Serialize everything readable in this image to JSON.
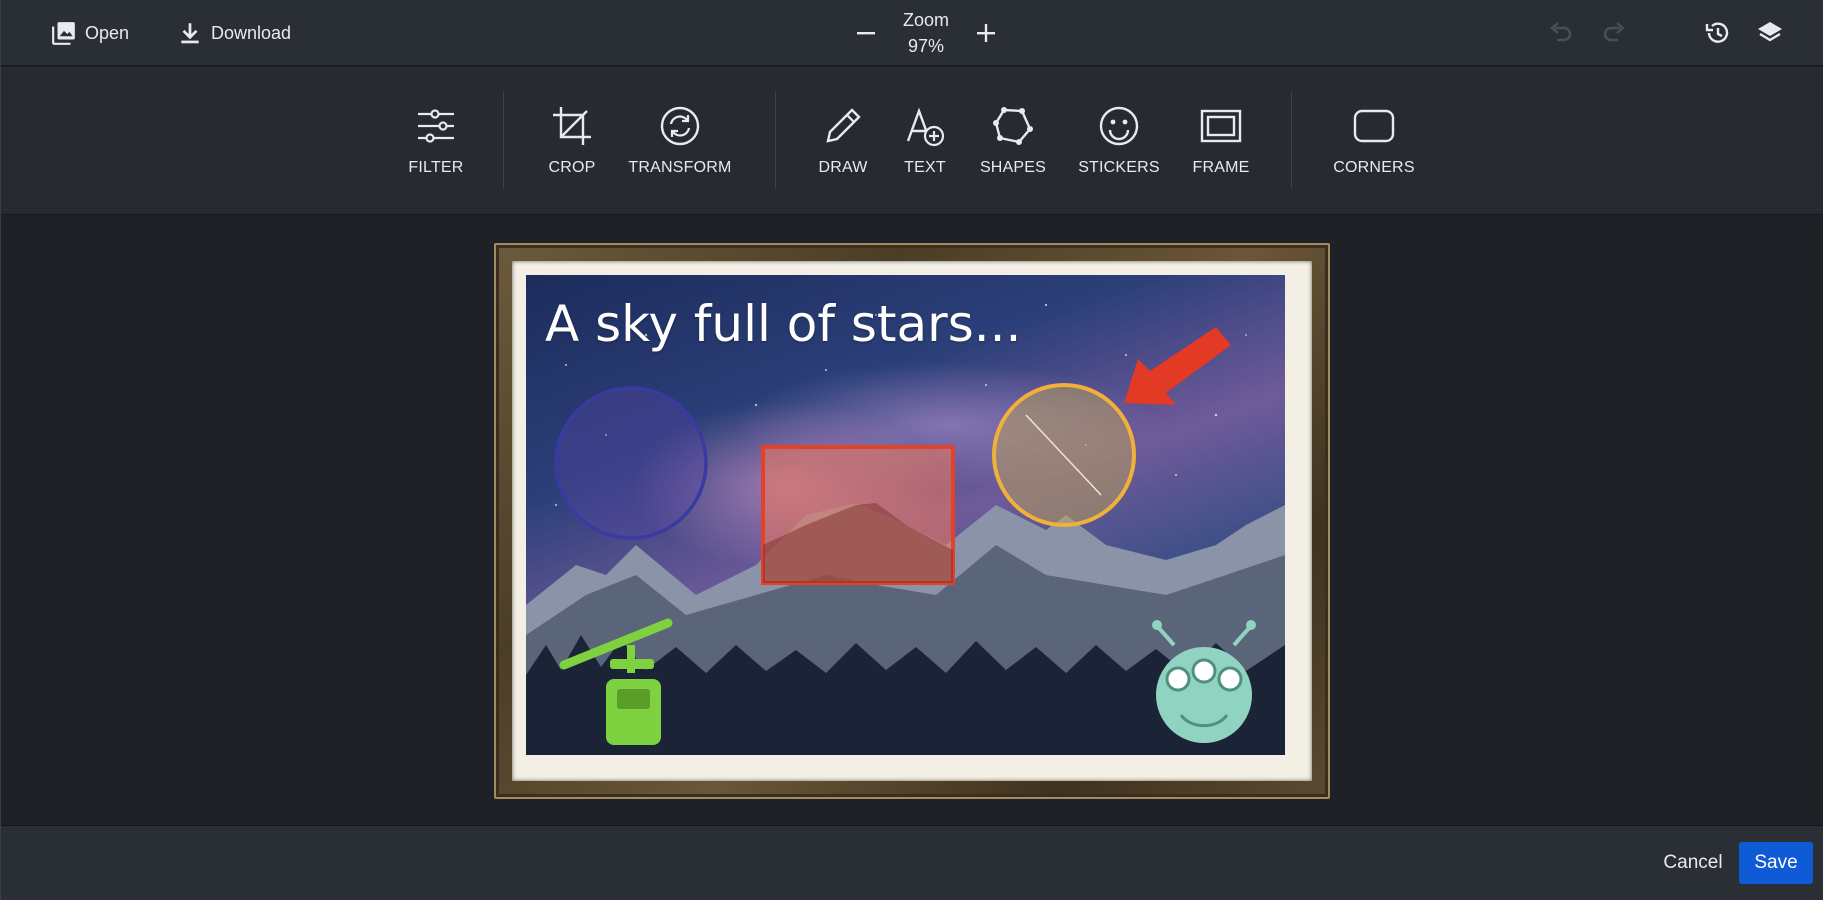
{
  "topbar": {
    "open_label": "Open",
    "download_label": "Download",
    "zoom_label": "Zoom",
    "zoom_value": "97%"
  },
  "tools": {
    "filter": "FILTER",
    "crop": "CROP",
    "transform": "TRANSFORM",
    "draw": "DRAW",
    "text": "TEXT",
    "shapes": "SHAPES",
    "stickers": "STICKERS",
    "frame": "FRAME",
    "corners": "CORNERS"
  },
  "canvas": {
    "text_annotation": "A sky full of stars...",
    "annotation_colors": {
      "purple_circle": "#3b3aa0",
      "red_rectangle": "#e0422a",
      "yellow_circle": "#f0b03a",
      "arrow": "#e33a25",
      "gondola_sticker": "#7fd23f",
      "alien_sticker": "#8fd3c0"
    }
  },
  "footer": {
    "cancel_label": "Cancel",
    "save_label": "Save"
  },
  "colors": {
    "accent": "#0e5ad7",
    "topbar_bg": "#2a2e35",
    "canvas_bg": "#1e2126"
  }
}
